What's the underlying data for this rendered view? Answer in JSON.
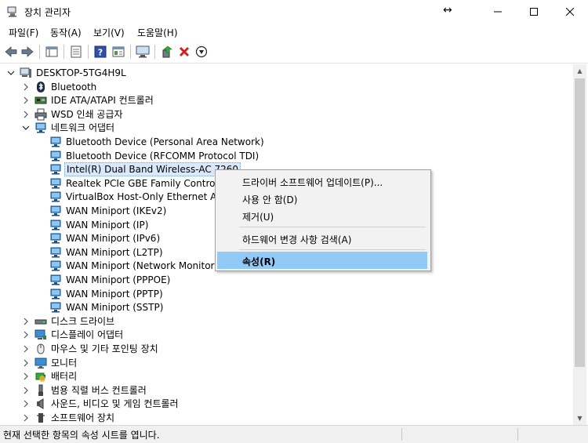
{
  "window": {
    "title": "장치 관리자",
    "resize_glyph": "↔",
    "minimize_icon": "minimize-icon",
    "maximize_icon": "maximize-icon",
    "close_icon": "close-icon"
  },
  "menu": {
    "items": [
      "파일(F)",
      "동작(A)",
      "보기(V)",
      "도움말(H)"
    ]
  },
  "toolbar": {
    "icons": [
      "back-icon",
      "forward-icon",
      "properties-pane-icon",
      "list-icon",
      "help-icon",
      "details-icon",
      "scan-monitor-icon",
      "update-driver-icon",
      "uninstall-icon",
      "disable-icon"
    ]
  },
  "tree": {
    "root": "DESKTOP-5TG4H9L",
    "categories_before": [
      {
        "label": "Bluetooth",
        "icon": "bluetooth-icon"
      },
      {
        "label": "IDE ATA/ATAPI 컨트롤러",
        "icon": "ide-controller-icon"
      },
      {
        "label": "WSD 인쇄 공급자",
        "icon": "printer-icon"
      }
    ],
    "network": {
      "label": "네트워크 어댑터",
      "children": [
        "Bluetooth Device (Personal Area Network)",
        "Bluetooth Device (RFCOMM Protocol TDI)",
        "Intel(R) Dual Band Wireless-AC 7260",
        "Realtek PCIe GBE Family Controller",
        "VirtualBox Host-Only Ethernet Adap",
        "WAN Miniport (IKEv2)",
        "WAN Miniport (IP)",
        "WAN Miniport (IPv6)",
        "WAN Miniport (L2TP)",
        "WAN Miniport (Network Monitor)",
        "WAN Miniport (PPPOE)",
        "WAN Miniport (PPTP)",
        "WAN Miniport (SSTP)"
      ],
      "selected_index": 2
    },
    "categories_after": [
      {
        "label": "디스크 드라이브",
        "icon": "disk-drive-icon"
      },
      {
        "label": "디스플레이 어댑터",
        "icon": "display-adapter-icon"
      },
      {
        "label": "마우스 및 기타 포인팅 장치",
        "icon": "mouse-icon"
      },
      {
        "label": "모니터",
        "icon": "monitor-icon"
      },
      {
        "label": "배터리",
        "icon": "battery-icon"
      },
      {
        "label": "범용 직렬 버스 컨트롤러",
        "icon": "usb-icon"
      },
      {
        "label": "사운드, 비디오 및 게임 컨트롤러",
        "icon": "speaker-icon"
      },
      {
        "label": "소프트웨어 장치",
        "icon": "software-device-icon"
      }
    ]
  },
  "context_menu": {
    "items": [
      {
        "label": "드라이버 소프트웨어 업데이트(P)...",
        "highlighted": false
      },
      {
        "label": "사용 안 함(D)",
        "highlighted": false
      },
      {
        "label": "제거(U)",
        "highlighted": false
      },
      {
        "label": "하드웨어 변경 사항 검색(A)",
        "highlighted": false
      },
      {
        "label": "속성(R)",
        "highlighted": true
      }
    ]
  },
  "status": {
    "text": "현재 선택한 항목의 속성 시트를 엽니다."
  },
  "colors": {
    "highlight": "#91c9f7",
    "selection": "#d9e8fb",
    "menu_bg": "#f2f2f2"
  }
}
